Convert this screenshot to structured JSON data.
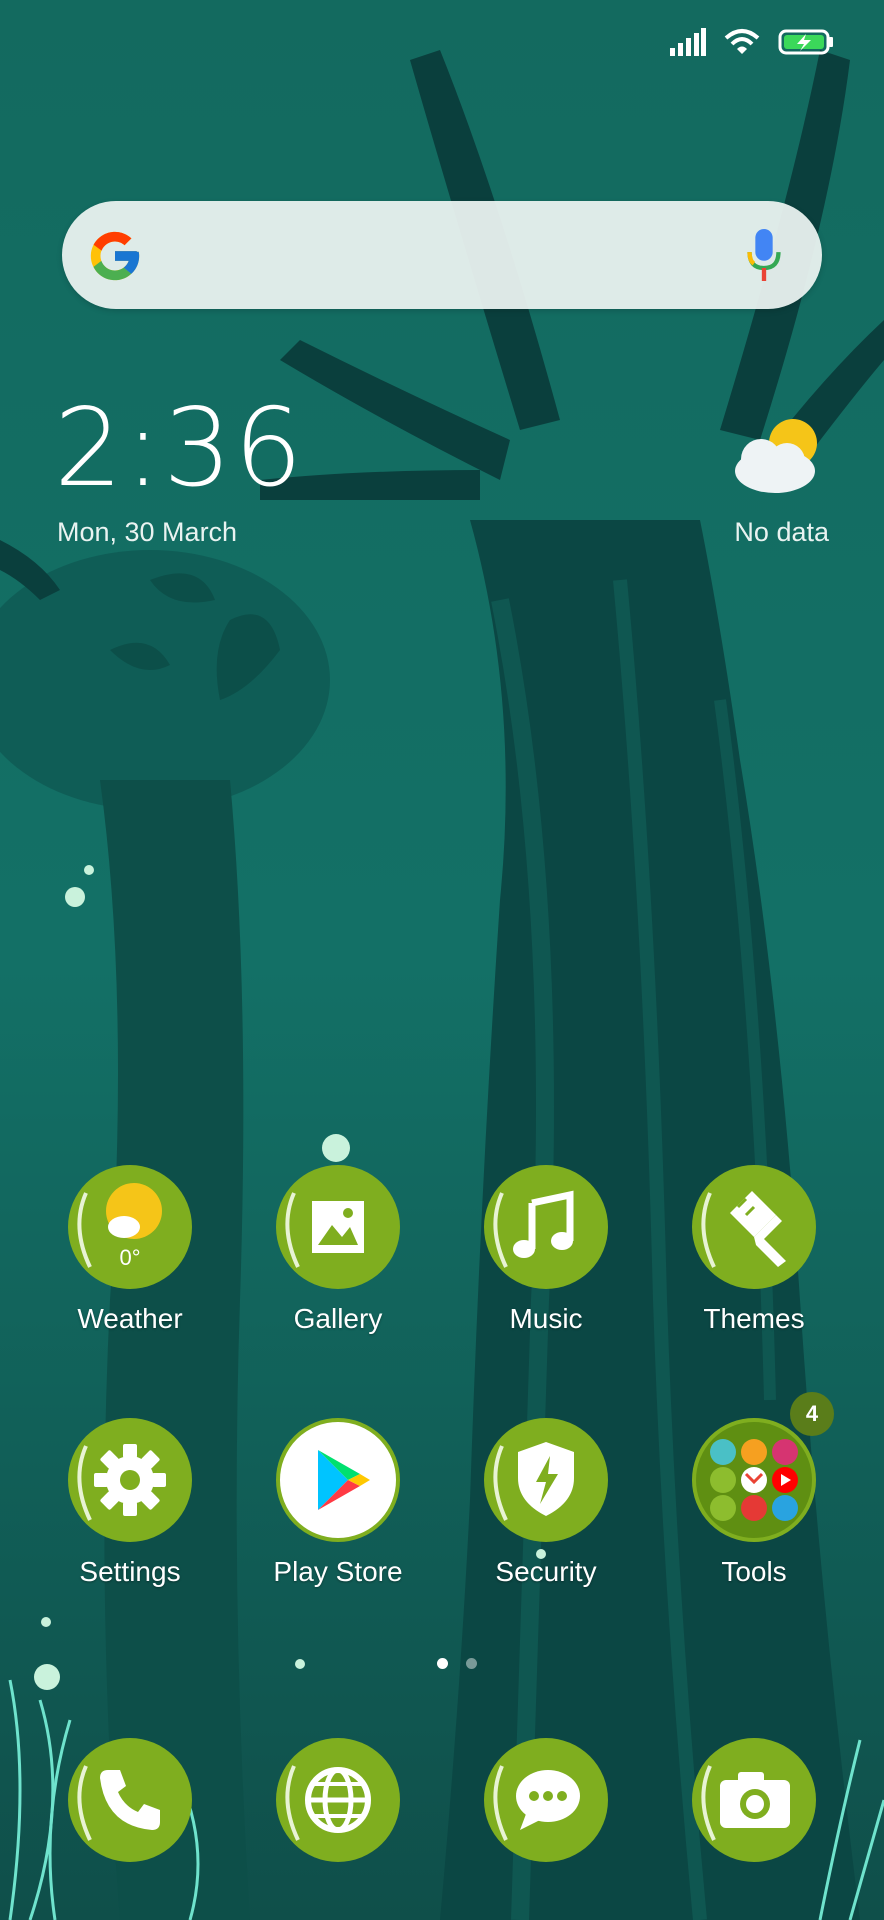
{
  "status_bar": {
    "icons": [
      "signal-icon",
      "wifi-icon",
      "battery-charging-icon"
    ]
  },
  "search": {
    "placeholder": ""
  },
  "clock": {
    "time": "2:36",
    "date": "Mon, 30 March"
  },
  "weather_widget": {
    "status": "No data"
  },
  "apps": {
    "weather": {
      "label": "Weather",
      "temp": "0°"
    },
    "gallery": {
      "label": "Gallery"
    },
    "music": {
      "label": "Music"
    },
    "themes": {
      "label": "Themes"
    },
    "settings": {
      "label": "Settings"
    },
    "play_store": {
      "label": "Play Store"
    },
    "security": {
      "label": "Security"
    },
    "tools": {
      "label": "Tools",
      "badge": "4"
    }
  },
  "dock": [
    "phone-icon",
    "browser-icon",
    "messages-icon",
    "camera-icon"
  ],
  "page_indicator": {
    "pages": 2,
    "active": 1
  },
  "colors": {
    "icon_green": "#7fae1f",
    "icon_green_dark": "#5f8f12",
    "accent_yellow": "#f5c518"
  }
}
